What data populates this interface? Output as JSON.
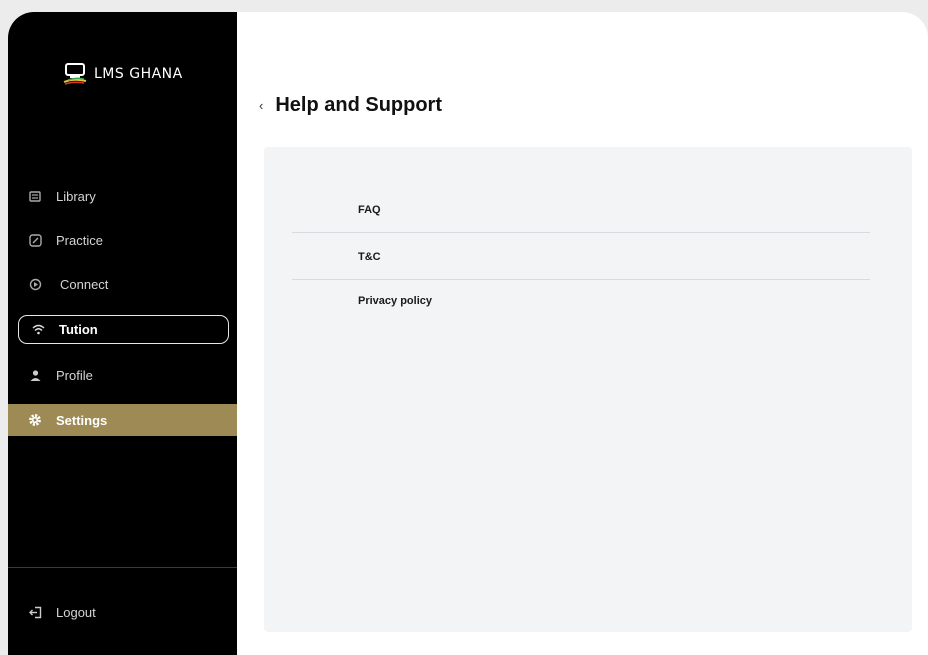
{
  "app": {
    "logo_text": "LMS GHANA"
  },
  "sidebar": {
    "items": [
      {
        "label": "Library",
        "icon": "library-icon"
      },
      {
        "label": "Practice",
        "icon": "practice-icon"
      },
      {
        "label": "Connect",
        "icon": "connect-icon"
      },
      {
        "label": "Tution",
        "icon": "wifi-icon"
      },
      {
        "label": "Profile",
        "icon": "profile-icon"
      },
      {
        "label": "Settings",
        "icon": "gear-icon"
      }
    ],
    "logout_label": "Logout"
  },
  "header": {
    "back_symbol": "‹",
    "title": "Help and Support"
  },
  "support_menu": {
    "items": [
      {
        "label": "FAQ"
      },
      {
        "label": "T&C"
      },
      {
        "label": "Privacy policy"
      }
    ]
  },
  "colors": {
    "sidebar_bg": "#000000",
    "active_bg": "#9e8a54",
    "panel_bg": "#f2f4f5"
  }
}
